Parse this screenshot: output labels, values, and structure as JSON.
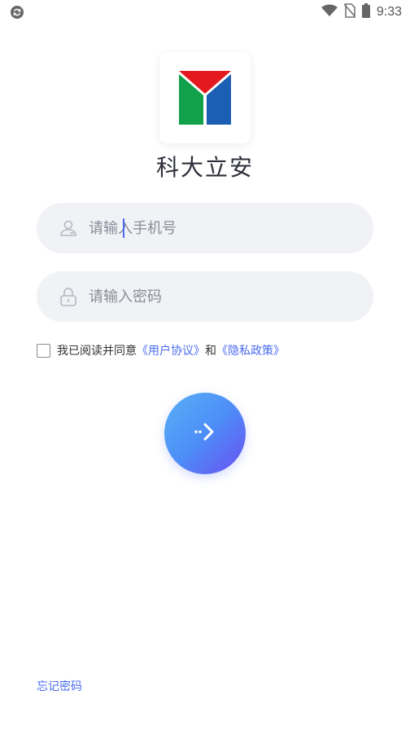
{
  "status_bar": {
    "time": "9:33"
  },
  "app": {
    "title": "科大立安"
  },
  "login": {
    "phone_placeholder": "请输入手机号",
    "password_placeholder": "请输入密码",
    "agreement_prefix": "我已阅读并同意",
    "user_agreement": "《用户协议》",
    "and_text": "和",
    "privacy_policy": "《隐私政策》",
    "forgot_password": "忘记密码"
  },
  "colors": {
    "accent": "#4a6cf0",
    "field_bg": "#f1f2f6"
  }
}
